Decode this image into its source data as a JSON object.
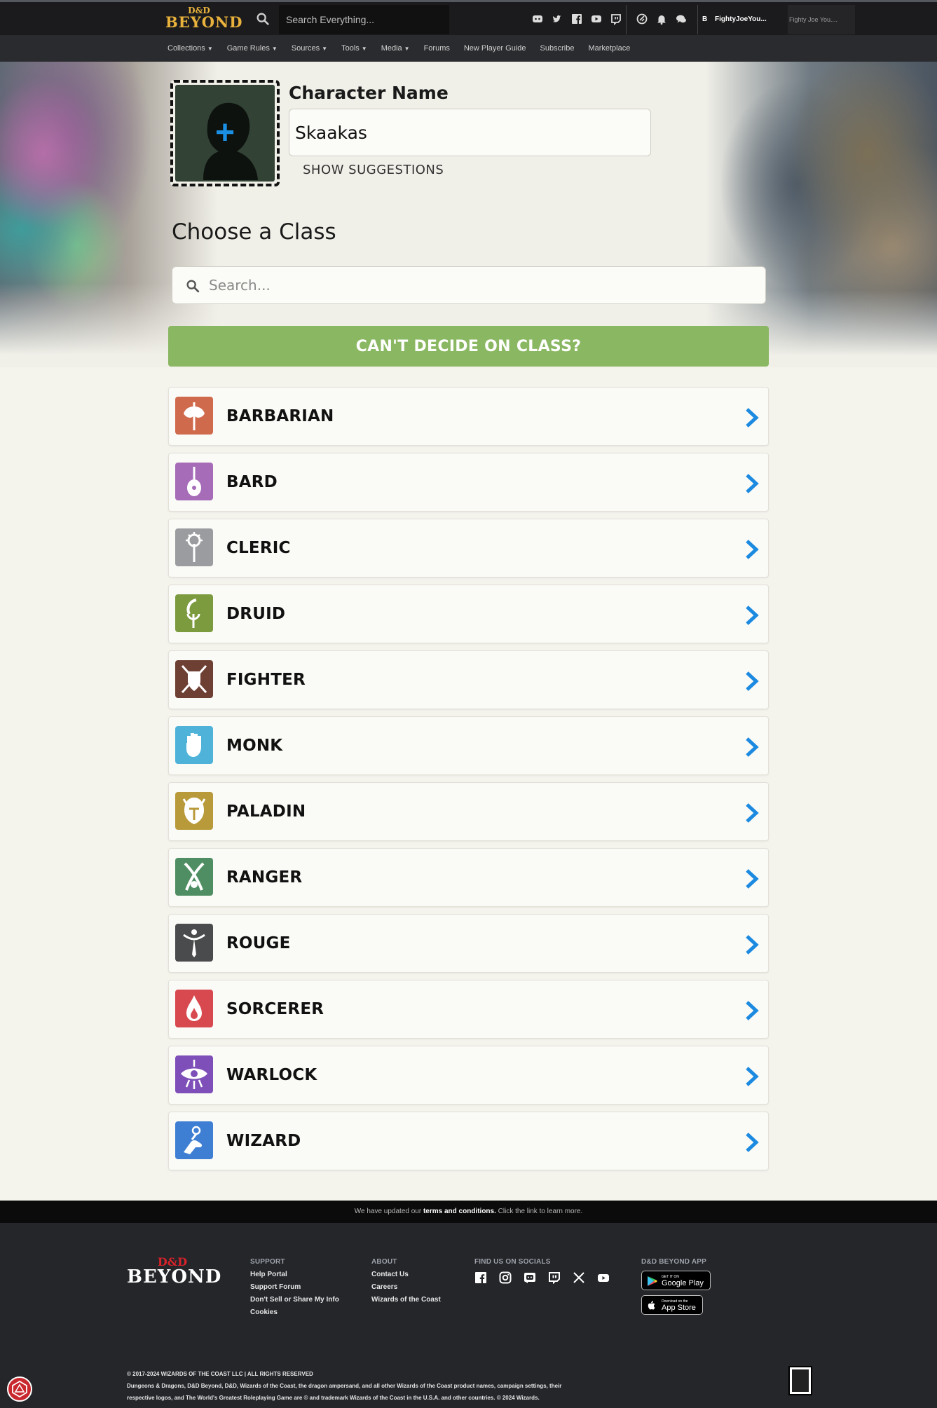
{
  "header": {
    "logo_small": "D&D",
    "logo_big": "BEYOND",
    "search_placeholder": "Search Everything...",
    "social_icons": [
      "discord-icon",
      "twitter-icon",
      "facebook-icon",
      "youtube-icon",
      "twitch-icon"
    ],
    "action_icons": [
      "dice-icon",
      "bell-icon",
      "chat-icon"
    ],
    "user_initial": "B",
    "user_name": "FightyJoeYou...",
    "user_secondary": "Fighty Joe You...."
  },
  "nav": {
    "items": [
      {
        "label": "Collections",
        "caret": true
      },
      {
        "label": "Game Rules",
        "caret": true
      },
      {
        "label": "Sources",
        "caret": true
      },
      {
        "label": "Tools",
        "caret": true
      },
      {
        "label": "Media",
        "caret": true
      },
      {
        "label": "Forums",
        "caret": false
      },
      {
        "label": "New Player Guide",
        "caret": false
      },
      {
        "label": "Subscribe",
        "caret": false
      },
      {
        "label": "Marketplace",
        "caret": false
      }
    ]
  },
  "builder": {
    "character_name_label": "Character Name",
    "character_name_value": "Skaakas",
    "show_suggestions": "SHOW SUGGESTIONS",
    "choose_class_title": "Choose a Class",
    "search_placeholder": "Search...",
    "cant_decide": "CAN'T DECIDE ON CLASS?"
  },
  "classes": [
    {
      "name": "BARBARIAN",
      "color": "#d06a4c",
      "icon": "axe-icon"
    },
    {
      "name": "BARD",
      "color": "#a66cb8",
      "icon": "lute-icon"
    },
    {
      "name": "CLERIC",
      "color": "#9a9c9f",
      "icon": "mace-icon"
    },
    {
      "name": "DRUID",
      "color": "#7c9a3e",
      "icon": "sickle-icon"
    },
    {
      "name": "FIGHTER",
      "color": "#6e3f33",
      "icon": "sword-shield-icon"
    },
    {
      "name": "MONK",
      "color": "#4fb3d9",
      "icon": "fist-icon"
    },
    {
      "name": "PALADIN",
      "color": "#b89a3a",
      "icon": "helm-icon"
    },
    {
      "name": "RANGER",
      "color": "#4e8e62",
      "icon": "crossed-blades-icon"
    },
    {
      "name": "ROUGE",
      "color": "#4a4b4c",
      "icon": "dagger-icon"
    },
    {
      "name": "SORCERER",
      "color": "#d8484f",
      "icon": "flame-icon"
    },
    {
      "name": "WARLOCK",
      "color": "#7e4fb8",
      "icon": "eye-icon"
    },
    {
      "name": "WIZARD",
      "color": "#3f7fd3",
      "icon": "hand-orb-icon"
    }
  ],
  "notice": {
    "prefix": "We have updated our",
    "link": "terms and conditions.",
    "suffix": "Click the link to learn more."
  },
  "footer": {
    "logo_small": "D&D",
    "logo_big": "BEYOND",
    "support": {
      "title": "SUPPORT",
      "links": [
        "Help Portal",
        "Support Forum",
        "Don't Sell or Share My Info",
        "Cookies"
      ]
    },
    "about": {
      "title": "ABOUT",
      "links": [
        "Contact Us",
        "Careers",
        "Wizards  of the Coast"
      ]
    },
    "socials": {
      "title": "FIND US ON SOCIALS",
      "icons": [
        "facebook-icon",
        "instagram-icon",
        "discord-icon",
        "twitch-icon",
        "x-icon",
        "youtube-icon"
      ]
    },
    "app": {
      "title": "D&D BEYOND APP",
      "google_small": "GET IT ON",
      "google_big": "Google Play",
      "apple_small": "Download on the",
      "apple_big": "App Store"
    },
    "copyright_line1": "© 2017-2024 WIZARDS OF THE COAST LLC | ALL RIGHTS RESERVED",
    "copyright_line2": "Dungeons & Dragons, D&D Beyond, D&D, Wizards of the Coast, the dragon ampersand, and all other Wizards of the Coast product names, campaign settings, their",
    "copyright_line3": "respective logos, and The World's Greatest Roleplaying Game are © and trademark Wizards of the Coast in the U.S.A. and other countries. © 2024 Wizards."
  }
}
